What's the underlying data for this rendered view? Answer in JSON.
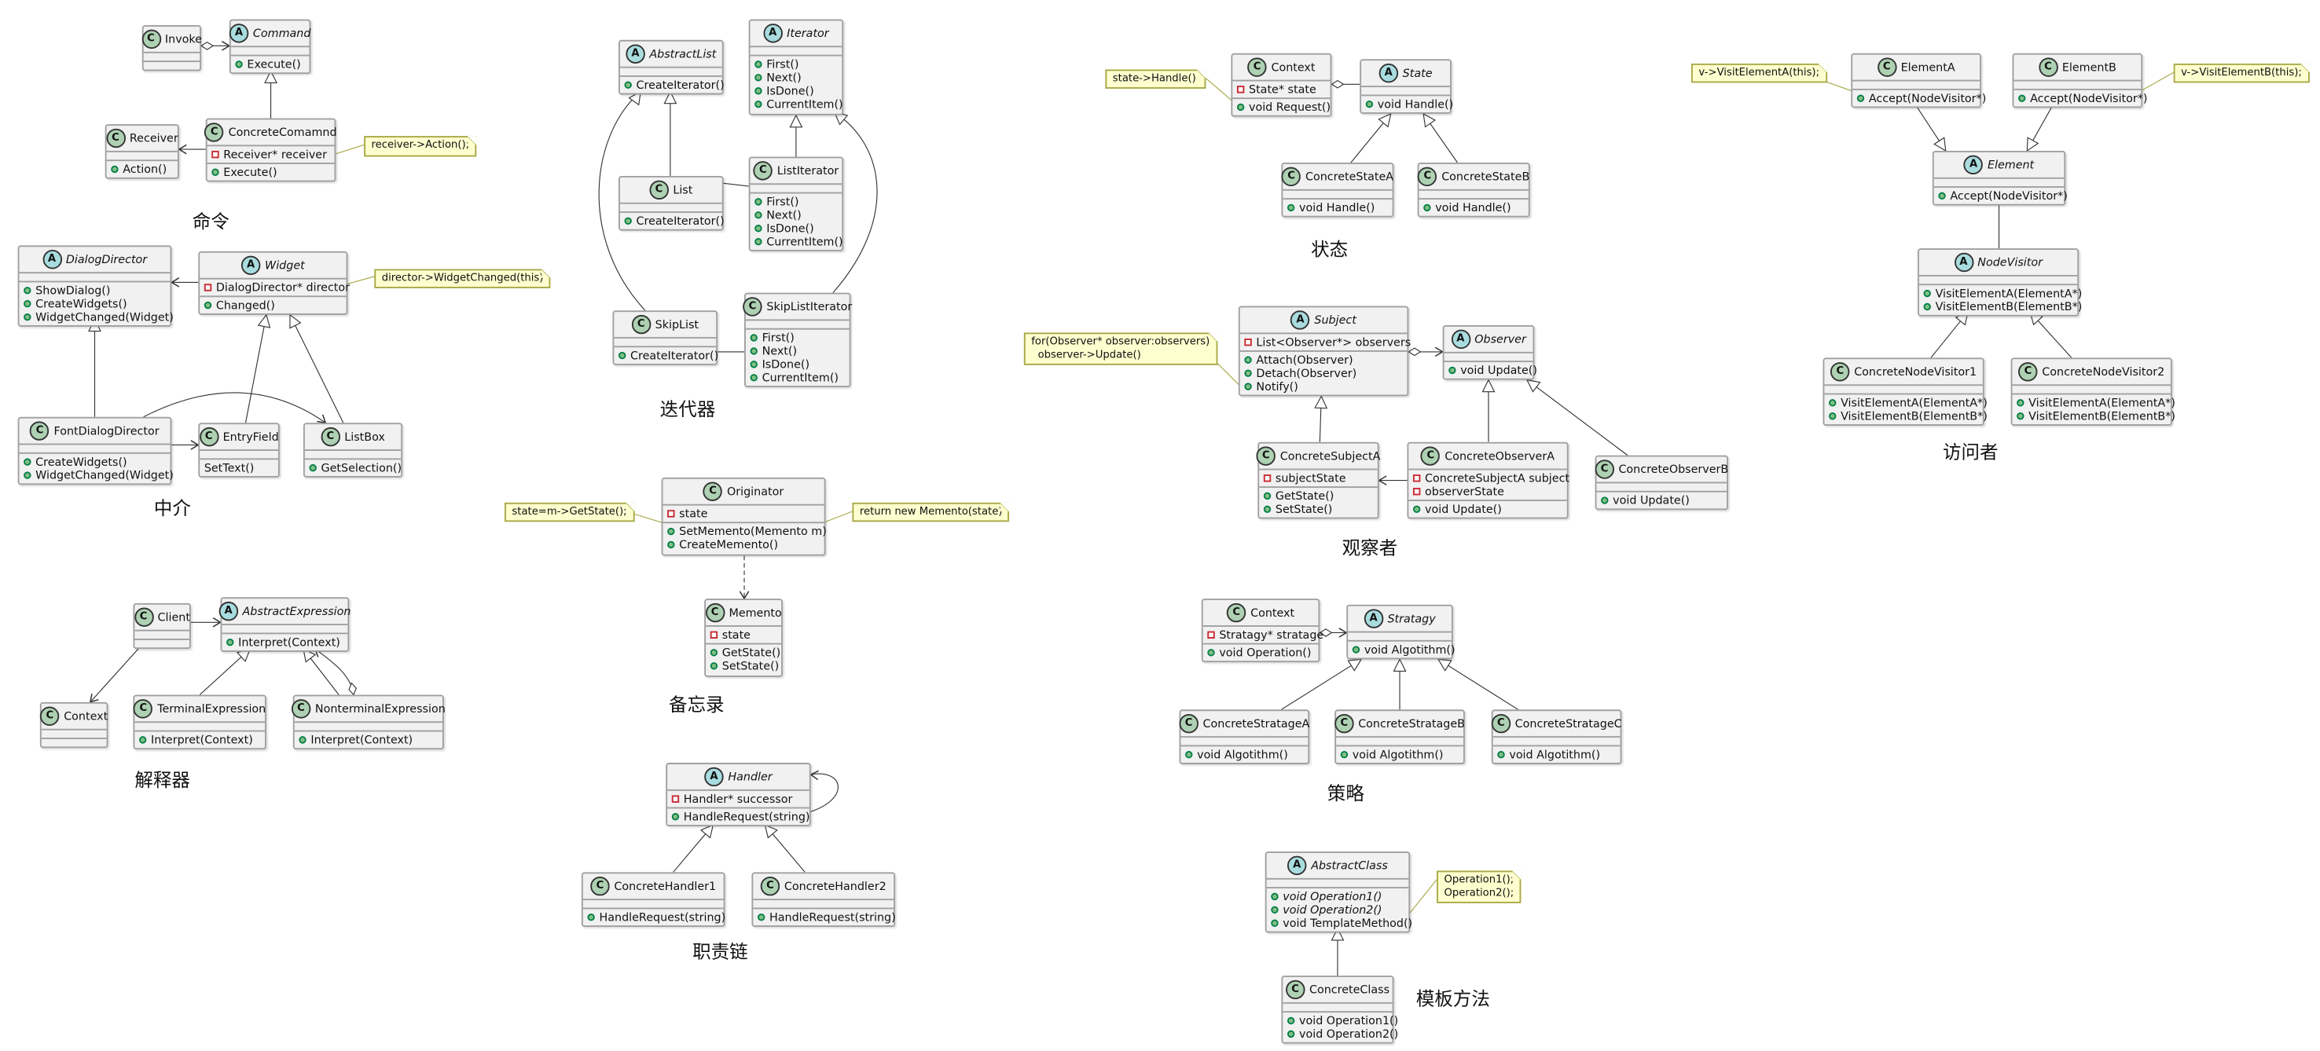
{
  "diagram": {
    "type": "UML class diagrams of design patterns",
    "patterns": [
      {
        "id": "command",
        "title": "命令",
        "classes": [
          {
            "id": "invoke",
            "name": "Invoke",
            "kind": "class",
            "fields": [],
            "methods": []
          },
          {
            "id": "command",
            "name": "Command",
            "kind": "abstract",
            "fields": [],
            "methods": [
              {
                "vis": "pub",
                "text": "Execute()"
              }
            ]
          },
          {
            "id": "receiver",
            "name": "Receiver",
            "kind": "class",
            "fields": [],
            "methods": [
              {
                "vis": "pub",
                "text": "Action()"
              }
            ]
          },
          {
            "id": "concretecommand",
            "name": "ConcreteComamnd",
            "kind": "class",
            "fields": [
              {
                "vis": "priv",
                "text": "Receiver* receiver"
              }
            ],
            "methods": [
              {
                "vis": "pub",
                "text": "Execute()"
              }
            ]
          }
        ],
        "notes": [
          {
            "id": "n1",
            "text": "receiver->Action();"
          }
        ]
      },
      {
        "id": "mediator",
        "title": "中介",
        "classes": [
          {
            "id": "dialogdirector",
            "name": "DialogDirector",
            "kind": "abstract",
            "fields": [],
            "methods": [
              {
                "vis": "pub",
                "text": "ShowDialog()"
              },
              {
                "vis": "pub",
                "text": "CreateWidgets()"
              },
              {
                "vis": "pub",
                "text": "WidgetChanged(Widget)"
              }
            ]
          },
          {
            "id": "widget",
            "name": "Widget",
            "kind": "abstract",
            "fields": [
              {
                "vis": "priv",
                "text": "DialogDirector* director"
              }
            ],
            "methods": [
              {
                "vis": "pub",
                "text": "Changed()"
              }
            ]
          },
          {
            "id": "fontdialogdirector",
            "name": "FontDialogDirector",
            "kind": "class",
            "fields": [],
            "methods": [
              {
                "vis": "pub",
                "text": "CreateWidgets()"
              },
              {
                "vis": "pub",
                "text": "WidgetChanged(Widget)"
              }
            ]
          },
          {
            "id": "entryfield",
            "name": "EntryField",
            "kind": "class",
            "fields": [],
            "methods": [
              {
                "vis": "none",
                "text": "SetText()"
              }
            ]
          },
          {
            "id": "listbox",
            "name": "ListBox",
            "kind": "class",
            "fields": [],
            "methods": [
              {
                "vis": "pub",
                "text": "GetSelection()"
              }
            ]
          }
        ],
        "notes": [
          {
            "id": "n1",
            "text": "director->WidgetChanged(this)"
          }
        ]
      },
      {
        "id": "interpreter",
        "title": "解释器",
        "classes": [
          {
            "id": "client",
            "name": "Client",
            "kind": "class",
            "fields": [],
            "methods": []
          },
          {
            "id": "abstractexpression",
            "name": "AbstractExpression",
            "kind": "abstract",
            "fields": [],
            "methods": [
              {
                "vis": "pub",
                "text": "Interpret(Context)"
              }
            ]
          },
          {
            "id": "context",
            "name": "Context",
            "kind": "class",
            "fields": [],
            "methods": []
          },
          {
            "id": "terminalexpression",
            "name": "TerminalExpression",
            "kind": "class",
            "fields": [],
            "methods": [
              {
                "vis": "pub",
                "text": "Interpret(Context)"
              }
            ]
          },
          {
            "id": "nonterminalexpression",
            "name": "NonterminalExpression",
            "kind": "class",
            "fields": [],
            "methods": [
              {
                "vis": "pub",
                "text": "Interpret(Context)"
              }
            ]
          }
        ],
        "notes": []
      },
      {
        "id": "iterator",
        "title": "迭代器",
        "classes": [
          {
            "id": "abstractlist",
            "name": "AbstractList",
            "kind": "abstract",
            "fields": [],
            "methods": [
              {
                "vis": "pub",
                "text": "CreateIterator()"
              }
            ]
          },
          {
            "id": "iterator",
            "name": "Iterator",
            "kind": "abstract",
            "fields": [],
            "methods": [
              {
                "vis": "pub",
                "text": "First()"
              },
              {
                "vis": "pub",
                "text": "Next()"
              },
              {
                "vis": "pub",
                "text": "IsDone()"
              },
              {
                "vis": "pub",
                "text": "CurrentItem()"
              }
            ]
          },
          {
            "id": "list",
            "name": "List",
            "kind": "class",
            "fields": [],
            "methods": [
              {
                "vis": "pub",
                "text": "CreateIterator()"
              }
            ]
          },
          {
            "id": "listiterator",
            "name": "ListIterator",
            "kind": "class",
            "fields": [],
            "methods": [
              {
                "vis": "pub",
                "text": "First()"
              },
              {
                "vis": "pub",
                "text": "Next()"
              },
              {
                "vis": "pub",
                "text": "IsDone()"
              },
              {
                "vis": "pub",
                "text": "CurrentItem()"
              }
            ]
          },
          {
            "id": "skiplist",
            "name": "SkipList",
            "kind": "class",
            "fields": [],
            "methods": [
              {
                "vis": "pub",
                "text": "CreateIterator()"
              }
            ]
          },
          {
            "id": "skiplistiterator",
            "name": "SkipListIterator",
            "kind": "class",
            "fields": [],
            "methods": [
              {
                "vis": "pub",
                "text": "First()"
              },
              {
                "vis": "pub",
                "text": "Next()"
              },
              {
                "vis": "pub",
                "text": "IsDone()"
              },
              {
                "vis": "pub",
                "text": "CurrentItem()"
              }
            ]
          }
        ],
        "notes": []
      },
      {
        "id": "memento",
        "title": "备忘录",
        "classes": [
          {
            "id": "originator",
            "name": "Originator",
            "kind": "class",
            "fields": [
              {
                "vis": "priv",
                "text": "state"
              }
            ],
            "methods": [
              {
                "vis": "pub",
                "text": "SetMemento(Memento m)"
              },
              {
                "vis": "pub",
                "text": "CreateMemento()"
              }
            ]
          },
          {
            "id": "memento",
            "name": "Memento",
            "kind": "class",
            "fields": [
              {
                "vis": "priv",
                "text": "state"
              }
            ],
            "methods": [
              {
                "vis": "pub",
                "text": "GetState()"
              },
              {
                "vis": "pub",
                "text": "SetState()"
              }
            ]
          }
        ],
        "notes": [
          {
            "id": "n1",
            "text": "state=m->GetState();"
          },
          {
            "id": "n2",
            "text": "return new Memento(state)"
          }
        ]
      },
      {
        "id": "chain",
        "title": "职责链",
        "classes": [
          {
            "id": "handler",
            "name": "Handler",
            "kind": "abstract",
            "fields": [
              {
                "vis": "priv",
                "text": "Handler* successor"
              }
            ],
            "methods": [
              {
                "vis": "pub",
                "text": "HandleRequest(string)"
              }
            ]
          },
          {
            "id": "concretehandler1",
            "name": "ConcreteHandler1",
            "kind": "class",
            "fields": [],
            "methods": [
              {
                "vis": "pub",
                "text": "HandleRequest(string)"
              }
            ]
          },
          {
            "id": "concretehandler2",
            "name": "ConcreteHandler2",
            "kind": "class",
            "fields": [],
            "methods": [
              {
                "vis": "pub",
                "text": "HandleRequest(string)"
              }
            ]
          }
        ],
        "notes": []
      },
      {
        "id": "state",
        "title": "状态",
        "classes": [
          {
            "id": "context",
            "name": "Context",
            "kind": "class",
            "fields": [
              {
                "vis": "priv",
                "text": "State* state"
              }
            ],
            "methods": [
              {
                "vis": "pub",
                "text": "void Request()"
              }
            ]
          },
          {
            "id": "state",
            "name": "State",
            "kind": "abstract",
            "fields": [],
            "methods": [
              {
                "vis": "pub",
                "text": "void Handle()"
              }
            ]
          },
          {
            "id": "concretestatea",
            "name": "ConcreteStateA",
            "kind": "class",
            "fields": [],
            "methods": [
              {
                "vis": "pub",
                "text": "void Handle()"
              }
            ]
          },
          {
            "id": "concretestateb",
            "name": "ConcreteStateB",
            "kind": "class",
            "fields": [],
            "methods": [
              {
                "vis": "pub",
                "text": "void Handle()"
              }
            ]
          }
        ],
        "notes": [
          {
            "id": "n1",
            "text": "state->Handle()"
          }
        ]
      },
      {
        "id": "observer",
        "title": "观察者",
        "classes": [
          {
            "id": "subject",
            "name": "Subject",
            "kind": "abstract",
            "fields": [
              {
                "vis": "priv",
                "text": "List<Observer*> observers"
              }
            ],
            "methods": [
              {
                "vis": "pub",
                "text": "Attach(Observer)"
              },
              {
                "vis": "pub",
                "text": "Detach(Observer)"
              },
              {
                "vis": "pub",
                "text": "Notify()"
              }
            ]
          },
          {
            "id": "observer",
            "name": "Observer",
            "kind": "abstract",
            "fields": [],
            "methods": [
              {
                "vis": "pub",
                "text": "void Update()"
              }
            ]
          },
          {
            "id": "concretesubjecta",
            "name": "ConcreteSubjectA",
            "kind": "class",
            "fields": [
              {
                "vis": "priv",
                "text": "subjectState"
              }
            ],
            "methods": [
              {
                "vis": "pub",
                "text": "GetState()"
              },
              {
                "vis": "pub",
                "text": "SetState()"
              }
            ]
          },
          {
            "id": "concreteobservera",
            "name": "ConcreteObserverA",
            "kind": "class",
            "fields": [
              {
                "vis": "priv",
                "text": "ConcreteSubjectA subject"
              },
              {
                "vis": "priv",
                "text": "observerState"
              }
            ],
            "methods": [
              {
                "vis": "pub",
                "text": "void Update()"
              }
            ]
          },
          {
            "id": "concreteobserverb",
            "name": "ConcreteObserverB",
            "kind": "class",
            "fields": [],
            "methods": [
              {
                "vis": "pub",
                "text": "void Update()"
              }
            ]
          }
        ],
        "notes": [
          {
            "id": "n1",
            "text": "for(Observer* observer:observers)\n  observer->Update()"
          }
        ]
      },
      {
        "id": "strategy",
        "title": "策略",
        "classes": [
          {
            "id": "context",
            "name": "Context",
            "kind": "class",
            "fields": [
              {
                "vis": "priv",
                "text": "Stratagy* stratage"
              }
            ],
            "methods": [
              {
                "vis": "pub",
                "text": "void Operation()"
              }
            ]
          },
          {
            "id": "stratagy",
            "name": "Stratagy",
            "kind": "abstract",
            "fields": [],
            "methods": [
              {
                "vis": "pub",
                "text": "void Algotithm()"
              }
            ]
          },
          {
            "id": "concretestratagea",
            "name": "ConcreteStratageA",
            "kind": "class",
            "fields": [],
            "methods": [
              {
                "vis": "pub",
                "text": "void Algotithm()"
              }
            ]
          },
          {
            "id": "concretestratageb",
            "name": "ConcreteStratageB",
            "kind": "class",
            "fields": [],
            "methods": [
              {
                "vis": "pub",
                "text": "void Algotithm()"
              }
            ]
          },
          {
            "id": "concretestratagec",
            "name": "ConcreteStratageC",
            "kind": "class",
            "fields": [],
            "methods": [
              {
                "vis": "pub",
                "text": "void Algotithm()"
              }
            ]
          }
        ],
        "notes": []
      },
      {
        "id": "template",
        "title": "模板方法",
        "classes": [
          {
            "id": "abstractclass",
            "name": "AbstractClass",
            "kind": "abstract",
            "fields": [],
            "methods": [
              {
                "vis": "pub",
                "text": "void Operation1()",
                "italic": true
              },
              {
                "vis": "pub",
                "text": "void Operation2()",
                "italic": true
              },
              {
                "vis": "pub",
                "text": "void TemplateMethod()"
              }
            ]
          },
          {
            "id": "concreteclass",
            "name": "ConcreteClass",
            "kind": "class",
            "fields": [],
            "methods": [
              {
                "vis": "pub",
                "text": "void Operation1()"
              },
              {
                "vis": "pub",
                "text": "void Operation2()"
              }
            ]
          }
        ],
        "notes": [
          {
            "id": "n1",
            "text": "Operation1();\nOperation2();"
          }
        ]
      },
      {
        "id": "visitor",
        "title": "访问者",
        "classes": [
          {
            "id": "elementa",
            "name": "ElementA",
            "kind": "class",
            "fields": [],
            "methods": [
              {
                "vis": "pub",
                "text": "Accept(NodeVisitor*)"
              }
            ]
          },
          {
            "id": "elementb",
            "name": "ElementB",
            "kind": "class",
            "fields": [],
            "methods": [
              {
                "vis": "pub",
                "text": "Accept(NodeVisitor*)"
              }
            ]
          },
          {
            "id": "element",
            "name": "Element",
            "kind": "abstract",
            "fields": [],
            "methods": [
              {
                "vis": "pub",
                "text": "Accept(NodeVisitor*)"
              }
            ]
          },
          {
            "id": "nodevisitor",
            "name": "NodeVisitor",
            "kind": "abstract",
            "fields": [],
            "methods": [
              {
                "vis": "pub",
                "text": "VisitElementA(ElementA*)"
              },
              {
                "vis": "pub",
                "text": "VisitElementB(ElementB*)"
              }
            ]
          },
          {
            "id": "concretenodevisitor1",
            "name": "ConcreteNodeVisitor1",
            "kind": "class",
            "fields": [],
            "methods": [
              {
                "vis": "pub",
                "text": "VisitElementA(ElementA*)"
              },
              {
                "vis": "pub",
                "text": "VisitElementB(ElementB*)"
              }
            ]
          },
          {
            "id": "concretenodevisitor2",
            "name": "ConcreteNodeVisitor2",
            "kind": "class",
            "fields": [],
            "methods": [
              {
                "vis": "pub",
                "text": "VisitElementA(ElementA*)"
              },
              {
                "vis": "pub",
                "text": "VisitElementB(ElementB*)"
              }
            ]
          }
        ],
        "notes": [
          {
            "id": "n1",
            "text": "v->VisitElementA(this);"
          },
          {
            "id": "n2",
            "text": "v->VisitElementB(this);"
          }
        ]
      }
    ],
    "badges": {
      "class": "C",
      "abstract": "A"
    },
    "colors": {
      "class_badge": "#add1b2",
      "abstract_badge": "#a9dcdf",
      "box_fill": "#f1f1f1",
      "note_fill": "#fefece",
      "public_marker": "#84be84",
      "private_marker": "#c82930"
    }
  }
}
